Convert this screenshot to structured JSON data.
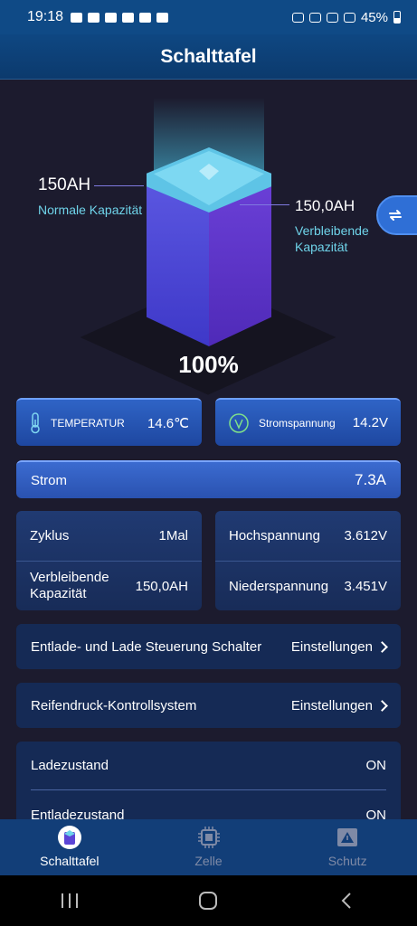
{
  "status_bar": {
    "time": "19:18",
    "battery": "45%"
  },
  "header": {
    "title": "Schalttafel"
  },
  "battery": {
    "nominal_value": "150AH",
    "nominal_label": "Normale Kapazität",
    "remaining_value": "150,0AH",
    "remaining_label_line1": "Verbleibende",
    "remaining_label_line2": "Kapazität",
    "percent": "100%"
  },
  "metrics": {
    "temperature_label": "TEMPERATUR",
    "temperature_value": "14.6℃",
    "voltage_label": "Stromspannung",
    "voltage_value": "14.2V"
  },
  "current": {
    "label": "Strom",
    "value": "7.3A"
  },
  "info": {
    "cycle_label": "Zyklus",
    "cycle_value": "1Mal",
    "high_label": "Hochspannung",
    "high_value": "3.612V",
    "remaining_label_line1": "Verbleibende",
    "remaining_label_line2": "Kapazität",
    "remaining_value": "150,0AH",
    "low_label": "Niederspannung",
    "low_value": "3.451V"
  },
  "settings": [
    {
      "label": "Entlade- und Lade Steuerung Schalter",
      "action": "Einstellungen"
    },
    {
      "label": "Reifendruck-Kontrollsystem",
      "action": "Einstellungen"
    }
  ],
  "states": [
    {
      "label": "Ladezustand",
      "value": "ON"
    },
    {
      "label": "Entladezustand",
      "value": "ON"
    }
  ],
  "nav": [
    {
      "label": "Schalttafel",
      "icon": "battery-icon",
      "active": true
    },
    {
      "label": "Zelle",
      "icon": "cell-chip-icon",
      "active": false
    },
    {
      "label": "Schutz",
      "icon": "warning-icon",
      "active": false
    }
  ]
}
